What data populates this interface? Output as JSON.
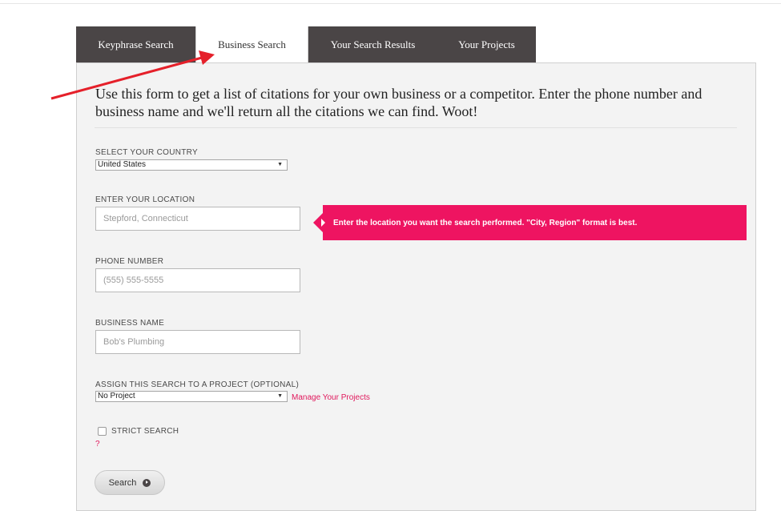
{
  "tabs": [
    {
      "label": "Keyphrase Search"
    },
    {
      "label": "Business Search"
    },
    {
      "label": "Your Search Results"
    },
    {
      "label": "Your Projects"
    }
  ],
  "intro": "Use this form to get a list of citations for your own business or a competitor. Enter the phone number and business name and we'll return all the citations we can find. Woot!",
  "country": {
    "label": "SELECT YOUR COUNTRY",
    "value": "United States"
  },
  "location": {
    "label": "ENTER YOUR LOCATION",
    "placeholder": "Stepford, Connecticut",
    "tooltip": "Enter the location you want the search performed. \"City, Region\" format is best."
  },
  "phone": {
    "label": "PHONE NUMBER",
    "placeholder": "(555) 555-5555"
  },
  "business": {
    "label": "BUSINESS NAME",
    "placeholder": "Bob's Plumbing"
  },
  "project": {
    "label": "ASSIGN THIS SEARCH TO A PROJECT (OPTIONAL)",
    "value": "No Project",
    "manage_link": "Manage Your Projects"
  },
  "strict": {
    "label": "STRICT SEARCH",
    "help": "?"
  },
  "search_button": "Search",
  "colors": {
    "accent": "#ee1461",
    "tab_dark": "#4a4546",
    "annotation_arrow": "#e5202a"
  }
}
